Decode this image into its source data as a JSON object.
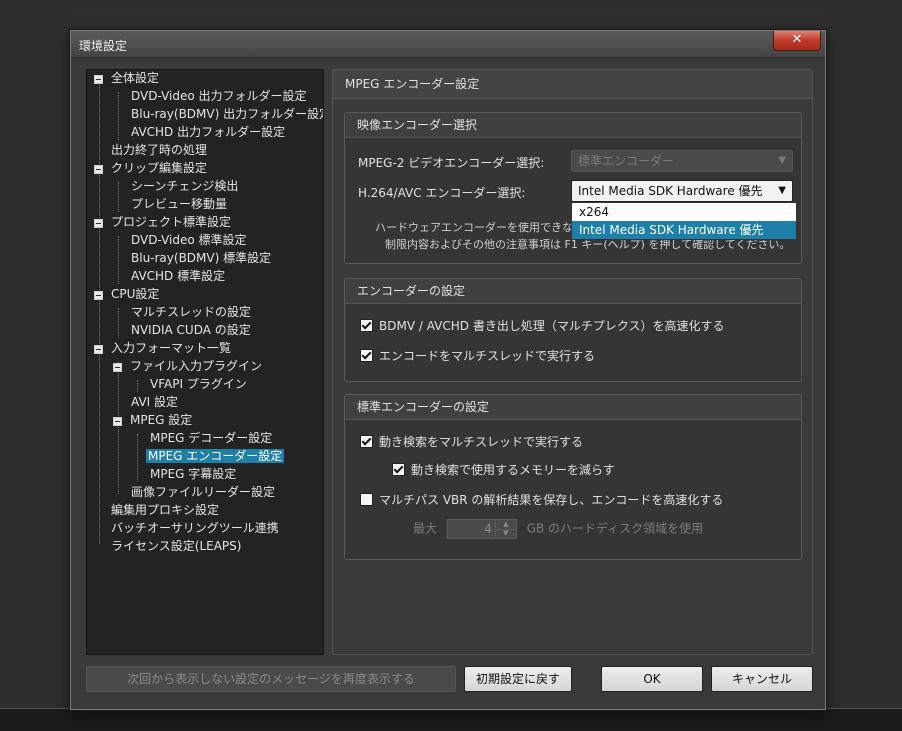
{
  "window": {
    "title": "環境設定",
    "close": "✕"
  },
  "tree": [
    "全体設定",
    "DVD-Video 出力フォルダー設定",
    "Blu-ray(BDMV) 出力フォルダー設定",
    "AVCHD 出力フォルダー設定",
    "出力終了時の処理",
    "クリップ編集設定",
    "シーンチェンジ検出",
    "プレビュー移動量",
    "プロジェクト標準設定",
    "DVD-Video 標準設定",
    "Blu-ray(BDMV) 標準設定",
    "AVCHD 標準設定",
    "CPU設定",
    "マルチスレッドの設定",
    "NVIDIA CUDA の設定",
    "入力フォーマット一覧",
    "ファイル入力プラグイン",
    "VFAPI プラグイン",
    "AVI 設定",
    "MPEG 設定",
    "MPEG デコーダー設定",
    "MPEG エンコーダー設定",
    "MPEG 字幕設定",
    "画像ファイルリーダー設定",
    "編集用プロキシ設定",
    "バッチオーサリングツール連携",
    "ライセンス設定(LEAPS)"
  ],
  "panel": {
    "title": "MPEG エンコーダー設定",
    "video_encoder": {
      "title": "映像エンコーダー選択",
      "mpeg2_label": "MPEG-2 ビデオエンコーダー選択:",
      "mpeg2_value": "標準エンコーダー",
      "h264_label": "H.264/AVC エンコーダー選択:",
      "h264_value": "Intel Media SDK Hardware 優先",
      "h264_options": [
        "x264",
        "Intel Media SDK Hardware 優先"
      ],
      "note_line1": "ハードウェアエンコーダーを使用できない場",
      "note_line2": "制限内容およびその他の注意事項は F1 キー(ヘルプ) を押して確認してください。"
    },
    "encoder_settings": {
      "title": "エンコーダーの設定",
      "bdmv_fast": "BDMV / AVCHD 書き出し処理（マルチプレクス）を高速化する",
      "multithread": "エンコードをマルチスレッドで実行する"
    },
    "standard_encoder": {
      "title": "標準エンコーダーの設定",
      "motion_multithread": "動き検索をマルチスレッドで実行する",
      "reduce_memory": "動き検索で使用するメモリーを減らす",
      "multipass": "マルチパス VBR の解析結果を保存し、エンコードを高速化する",
      "max_label": "最大",
      "max_value": "4",
      "gb_label": "GB のハードディスク領域を使用"
    }
  },
  "buttons": {
    "reshow": "次回から表示しない設定のメッセージを再度表示する",
    "reset": "初期設定に戻す",
    "ok": "OK",
    "cancel": "キャンセル"
  }
}
